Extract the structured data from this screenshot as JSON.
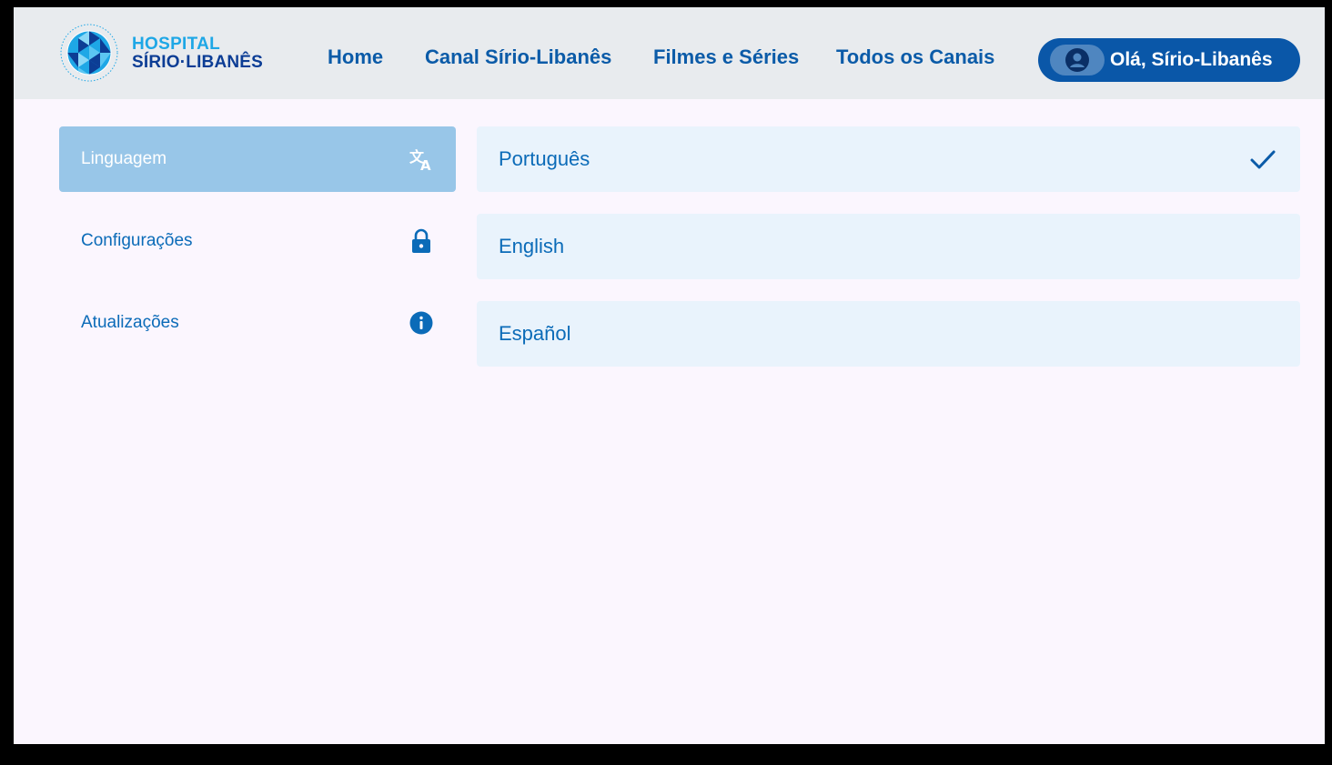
{
  "brand": {
    "line1": "HOSPITAL",
    "line2": "SÍRIO·LIBANÊS",
    "colors": {
      "accent_light": "#1ea7e6",
      "accent_dark": "#0c3d95"
    }
  },
  "nav": {
    "items": [
      {
        "label": "Home"
      },
      {
        "label": "Canal Sírio-Libanês"
      },
      {
        "label": "Filmes e Séries"
      },
      {
        "label": "Todos os Canais"
      }
    ],
    "user_button": {
      "label": "Olá, Sírio-Libanês",
      "icon": "user-avatar-icon"
    }
  },
  "sidebar": {
    "items": [
      {
        "label": "Linguagem",
        "icon": "translate-icon",
        "active": true
      },
      {
        "label": "Configurações",
        "icon": "lock-icon",
        "active": false
      },
      {
        "label": "Atualizações",
        "icon": "info-icon",
        "active": false
      }
    ]
  },
  "languages": {
    "options": [
      {
        "label": "Português",
        "selected": true
      },
      {
        "label": "English",
        "selected": false
      },
      {
        "label": "Español",
        "selected": false
      }
    ]
  },
  "colors": {
    "primary": "#0a57a8",
    "text_blue": "#0b6bb8",
    "sidebar_active_bg": "#98c6e8",
    "option_bg": "#e9f3fc",
    "page_bg": "#fbf6fe",
    "header_bg": "#e8ebee"
  }
}
